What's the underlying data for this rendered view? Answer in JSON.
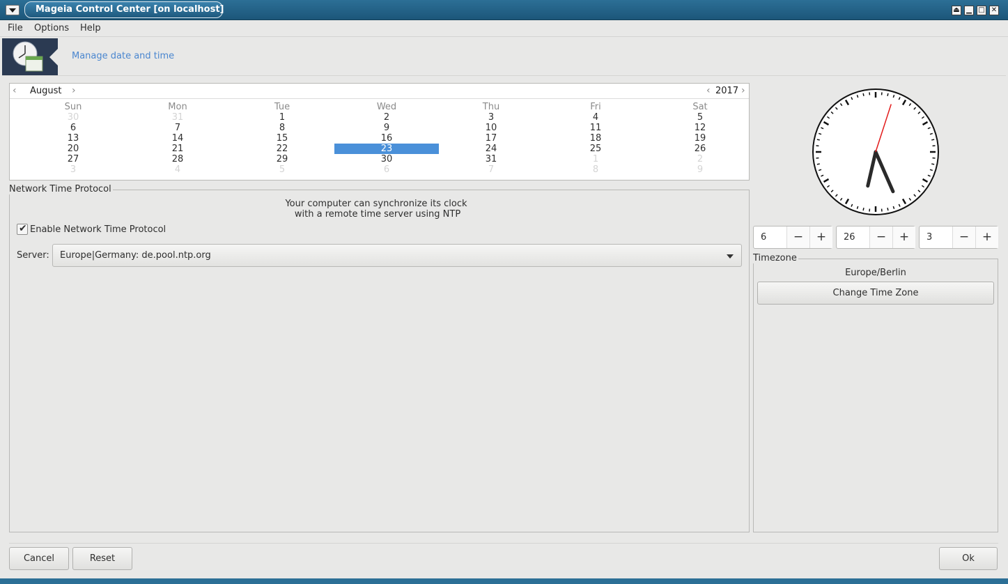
{
  "window": {
    "title": "Mageia Control Center  [on localhost]",
    "controls": [
      "⏏",
      "▁",
      "□",
      "✕"
    ]
  },
  "menubar": {
    "items": [
      "File",
      "Options",
      "Help"
    ]
  },
  "header": {
    "title": "Manage date and time"
  },
  "calendar": {
    "month": "August",
    "year": "2017",
    "prev_arrow": "‹",
    "next_arrow": "›",
    "weekdays": [
      "Sun",
      "Mon",
      "Tue",
      "Wed",
      "Thu",
      "Fri",
      "Sat"
    ],
    "weeks": [
      [
        [
          "30",
          "other"
        ],
        [
          "31",
          "other"
        ],
        [
          "1",
          ""
        ],
        [
          "2",
          ""
        ],
        [
          "3",
          ""
        ],
        [
          "4",
          ""
        ],
        [
          "5",
          ""
        ]
      ],
      [
        [
          "6",
          ""
        ],
        [
          "7",
          ""
        ],
        [
          "8",
          ""
        ],
        [
          "9",
          ""
        ],
        [
          "10",
          ""
        ],
        [
          "11",
          ""
        ],
        [
          "12",
          ""
        ]
      ],
      [
        [
          "13",
          ""
        ],
        [
          "14",
          ""
        ],
        [
          "15",
          ""
        ],
        [
          "16",
          ""
        ],
        [
          "17",
          ""
        ],
        [
          "18",
          ""
        ],
        [
          "19",
          ""
        ]
      ],
      [
        [
          "20",
          ""
        ],
        [
          "21",
          ""
        ],
        [
          "22",
          ""
        ],
        [
          "23",
          "sel"
        ],
        [
          "24",
          ""
        ],
        [
          "25",
          ""
        ],
        [
          "26",
          ""
        ]
      ],
      [
        [
          "27",
          ""
        ],
        [
          "28",
          ""
        ],
        [
          "29",
          ""
        ],
        [
          "30",
          ""
        ],
        [
          "31",
          ""
        ],
        [
          "1",
          "other"
        ],
        [
          "2",
          "other"
        ]
      ],
      [
        [
          "3",
          "other"
        ],
        [
          "4",
          "other"
        ],
        [
          "5",
          "other"
        ],
        [
          "6",
          "other"
        ],
        [
          "7",
          "other"
        ],
        [
          "8",
          "other"
        ],
        [
          "9",
          "other"
        ]
      ]
    ],
    "selected_color": "#4a90d9"
  },
  "ntp": {
    "legend": "Network Time Protocol",
    "description_line1": "Your computer can synchronize its clock",
    "description_line2": " with a remote time server using NTP",
    "enable_label": "Enable Network Time Protocol",
    "enable_checked": true,
    "server_label": "Server:",
    "server_value": "Europe|Germany: de.pool.ntp.org"
  },
  "clock": {
    "hours": 6,
    "minutes": 26,
    "seconds": 3
  },
  "time": {
    "hour": "6",
    "minute": "26",
    "second": "3",
    "minus": "−",
    "plus": "+"
  },
  "timezone": {
    "legend": "Timezone",
    "name": "Europe/Berlin",
    "change_button": "Change Time Zone"
  },
  "buttons": {
    "cancel": "Cancel",
    "reset": "Reset",
    "ok": "Ok"
  },
  "colors": {
    "titlebar": "#1c5679",
    "accent_text": "#4a86cf",
    "second_hand": "#e21b1b"
  }
}
